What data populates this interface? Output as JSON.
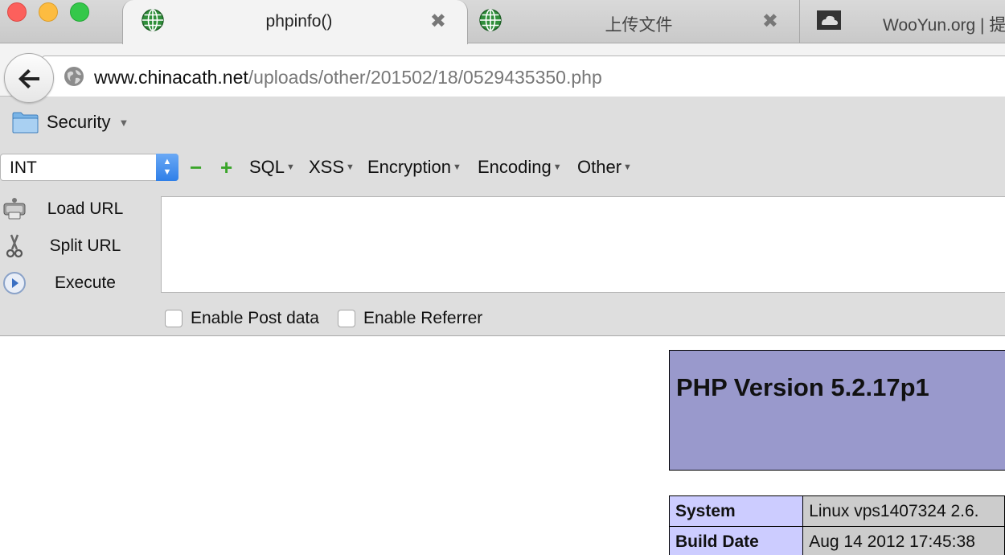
{
  "tabs": [
    {
      "title": "phpinfo()",
      "icon": "globe-icon",
      "active": true
    },
    {
      "title": "上传文件",
      "icon": "globe-icon",
      "active": false
    },
    {
      "title": "WooYun.org | 提",
      "icon": "wooyun-cloud-icon",
      "active": false
    }
  ],
  "navbar": {
    "url_domain": "www.chinacath.net",
    "url_path": "/uploads/other/201502/18/0529435350.php"
  },
  "hackbar": {
    "folder_label": "Security",
    "select_value": "INT",
    "menus": [
      "SQL",
      "XSS",
      "Encryption",
      "Encoding",
      "Other"
    ],
    "actions": {
      "load": "Load URL",
      "split": "Split URL",
      "execute": "Execute"
    },
    "textarea_value": "",
    "checkboxes": {
      "post": "Enable Post data",
      "referrer": "Enable Referrer"
    }
  },
  "phpinfo": {
    "title": "PHP Version 5.2.17p1",
    "rows": [
      {
        "key": "System",
        "value": "Linux vps1407324 2.6."
      },
      {
        "key": "Build Date",
        "value": "Aug 14 2012 17:45:38"
      }
    ]
  },
  "colors": {
    "php_header": "#9999cc",
    "php_key": "#ccccff",
    "php_value": "#cccccc",
    "hackbar_bg": "#dedede",
    "accent_green": "#3aa52a"
  }
}
